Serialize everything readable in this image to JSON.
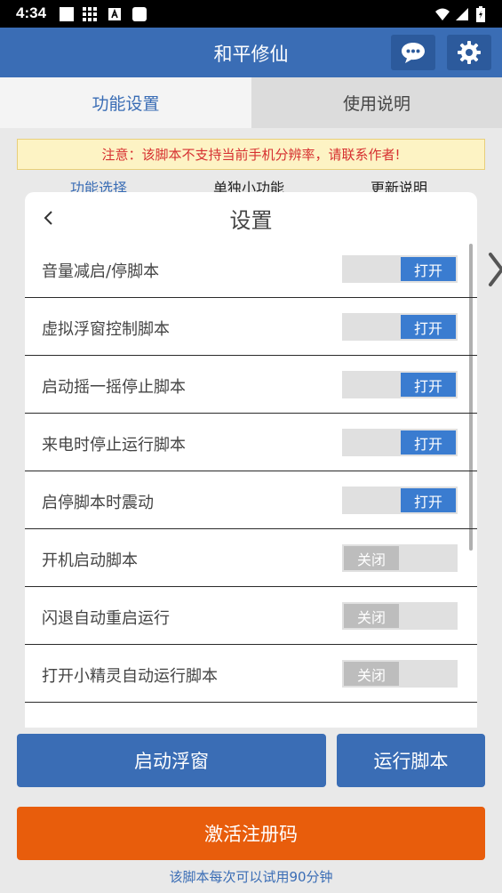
{
  "status_bar": {
    "time": "4:34"
  },
  "app_bar": {
    "title": "和平修仙",
    "icons": [
      "chat-icon",
      "gear-icon"
    ]
  },
  "tabs": [
    {
      "label": "功能设置",
      "active": true
    },
    {
      "label": "使用说明",
      "active": false
    }
  ],
  "notice": {
    "text": "注意：该脚本不支持当前手机分辨率，请联系作者!",
    "color": "#d63030"
  },
  "subnav": [
    "功能选择",
    "单独小功能",
    "更新说明"
  ],
  "dialog": {
    "title": "设置",
    "rows": [
      {
        "label": "音量减启/停脚本",
        "state": "打开",
        "on": true
      },
      {
        "label": "虚拟浮窗控制脚本",
        "state": "打开",
        "on": true
      },
      {
        "label": "启动摇一摇停止脚本",
        "state": "打开",
        "on": true
      },
      {
        "label": "来电时停止运行脚本",
        "state": "打开",
        "on": true
      },
      {
        "label": "启停脚本时震动",
        "state": "打开",
        "on": true
      },
      {
        "label": "开机启动脚本",
        "state": "关闭",
        "on": false
      },
      {
        "label": "闪退自动重启运行",
        "state": "关闭",
        "on": false
      },
      {
        "label": "打开小精灵自动运行脚本",
        "state": "关闭",
        "on": false
      }
    ]
  },
  "buttons": {
    "start_float": "启动浮窗",
    "run_script": "运行脚本",
    "activate": "激活注册码"
  },
  "trial_text": "该脚本每次可以试用90分钟",
  "colors": {
    "primary": "#3a6db5",
    "accent": "#e85d0c",
    "switch_on": "#3a7cd0"
  }
}
